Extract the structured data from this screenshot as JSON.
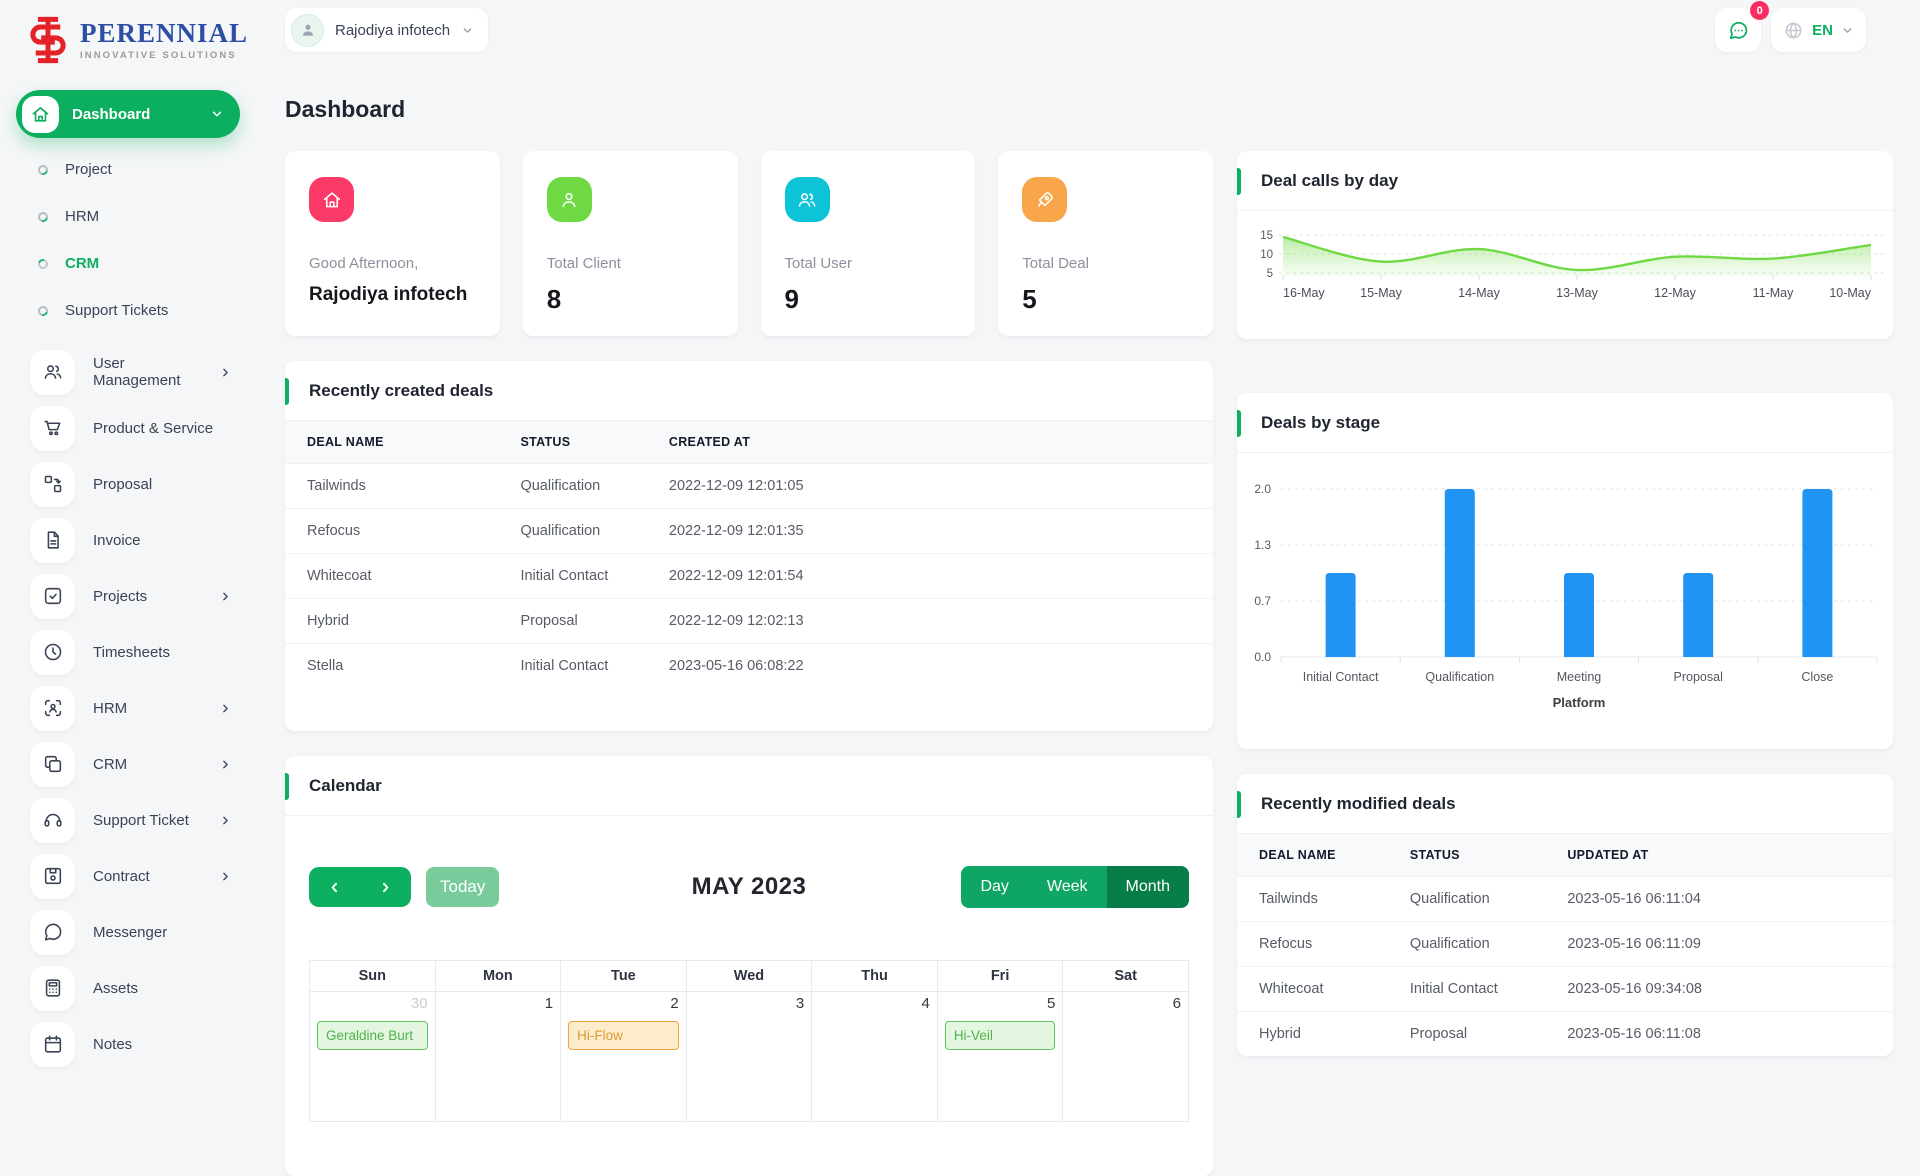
{
  "brand": {
    "name": "PERENNIAL",
    "tagline": "INNOVATIVE SOLUTIONS"
  },
  "header": {
    "company": "Rajodiya infotech",
    "notifications_badge": "0",
    "language": "EN"
  },
  "page_title": "Dashboard",
  "sidebar": {
    "dashboard_label": "Dashboard",
    "sub_items": [
      {
        "label": "Project",
        "active": false
      },
      {
        "label": "HRM",
        "active": false
      },
      {
        "label": "CRM",
        "active": true
      },
      {
        "label": "Support Tickets",
        "active": false
      }
    ],
    "menu_items": [
      {
        "label": "User Management",
        "icon": "users-icon",
        "chevron": true
      },
      {
        "label": "Product & Service",
        "icon": "cart-icon",
        "chevron": false
      },
      {
        "label": "Proposal",
        "icon": "workflow-icon",
        "chevron": false
      },
      {
        "label": "Invoice",
        "icon": "invoice-icon",
        "chevron": false
      },
      {
        "label": "Projects",
        "icon": "check-square-icon",
        "chevron": true
      },
      {
        "label": "Timesheets",
        "icon": "clock-icon",
        "chevron": false
      },
      {
        "label": "HRM",
        "icon": "user-scan-icon",
        "chevron": true
      },
      {
        "label": "CRM",
        "icon": "copy-icon",
        "chevron": true
      },
      {
        "label": "Support Ticket",
        "icon": "headset-icon",
        "chevron": true
      },
      {
        "label": "Contract",
        "icon": "floppy-icon",
        "chevron": true
      },
      {
        "label": "Messenger",
        "icon": "chat-icon",
        "chevron": false
      },
      {
        "label": "Assets",
        "icon": "calculator-icon",
        "chevron": false
      },
      {
        "label": "Notes",
        "icon": "calendar-icon",
        "chevron": false
      }
    ]
  },
  "cards": [
    {
      "type": "greeting",
      "label": "Good Afternoon,",
      "value": "Rajodiya infotech",
      "icon": "home-icon",
      "color": "#FB3A67"
    },
    {
      "type": "stat",
      "label": "Total Client",
      "value": "8",
      "icon": "user-icon",
      "color": "#6FD943"
    },
    {
      "type": "stat",
      "label": "Total User",
      "value": "9",
      "icon": "users-icon",
      "color": "#0CC3D8"
    },
    {
      "type": "stat",
      "label": "Total Deal",
      "value": "5",
      "icon": "rocket-icon",
      "color": "#F9A64A"
    }
  ],
  "created_deals": {
    "title": "Recently created deals",
    "columns": [
      "DEAL NAME",
      "STATUS",
      "CREATED AT"
    ],
    "rows": [
      [
        "Tailwinds",
        "Qualification",
        "2022-12-09 12:01:05"
      ],
      [
        "Refocus",
        "Qualification",
        "2022-12-09 12:01:35"
      ],
      [
        "Whitecoat",
        "Initial Contact",
        "2022-12-09 12:01:54"
      ],
      [
        "Hybrid",
        "Proposal",
        "2022-12-09 12:02:13"
      ],
      [
        "Stella",
        "Initial Contact",
        "2023-05-16 06:08:22"
      ]
    ]
  },
  "modified_deals": {
    "title": "Recently modified deals",
    "columns": [
      "DEAL NAME",
      "STATUS",
      "UPDATED AT"
    ],
    "rows": [
      [
        "Tailwinds",
        "Qualification",
        "2023-05-16 06:11:04"
      ],
      [
        "Refocus",
        "Qualification",
        "2023-05-16 06:11:09"
      ],
      [
        "Whitecoat",
        "Initial Contact",
        "2023-05-16 09:34:08"
      ],
      [
        "Hybrid",
        "Proposal",
        "2023-05-16 06:11:08"
      ]
    ]
  },
  "calendar": {
    "title": "Calendar",
    "toolbar": {
      "today_label": "Today",
      "month_title": "MAY 2023",
      "views": [
        "Day",
        "Week",
        "Month"
      ],
      "active_view": "Month"
    },
    "day_headers": [
      "Sun",
      "Mon",
      "Tue",
      "Wed",
      "Thu",
      "Fri",
      "Sat"
    ],
    "week": [
      {
        "date": "30",
        "muted": true,
        "event": {
          "label": "Geraldine Burt",
          "color": "green"
        }
      },
      {
        "date": "1"
      },
      {
        "date": "2",
        "event": {
          "label": "Hi-Flow",
          "color": "orange"
        }
      },
      {
        "date": "3"
      },
      {
        "date": "4"
      },
      {
        "date": "5",
        "event": {
          "label": "Hi-Veil",
          "color": "green"
        }
      },
      {
        "date": "6"
      }
    ]
  },
  "chart_data": [
    {
      "type": "area",
      "title": "Deal calls by day",
      "x": [
        "16-May",
        "15-May",
        "14-May",
        "13-May",
        "12-May",
        "11-May",
        "10-May"
      ],
      "values": [
        14.5,
        8,
        11.3,
        5.8,
        9.3,
        8.8,
        12.4
      ],
      "yticks": [
        15,
        10,
        5
      ],
      "ylim": [
        5,
        15
      ],
      "color": "#6FD943",
      "grid": "dashed-horizontal",
      "legend": "none"
    },
    {
      "type": "bar",
      "title": "Deals by stage",
      "categories": [
        "Initial Contact",
        "Qualification",
        "Meeting",
        "Proposal",
        "Close"
      ],
      "values": [
        1,
        2,
        1,
        1,
        2
      ],
      "ytick_labels": [
        "0.0",
        "0.7",
        "1.3",
        "2.0"
      ],
      "ylim": [
        0,
        2
      ],
      "xlabel": "Platform",
      "color": "#2094F3",
      "grid": "dashed-horizontal",
      "legend": "none"
    }
  ]
}
